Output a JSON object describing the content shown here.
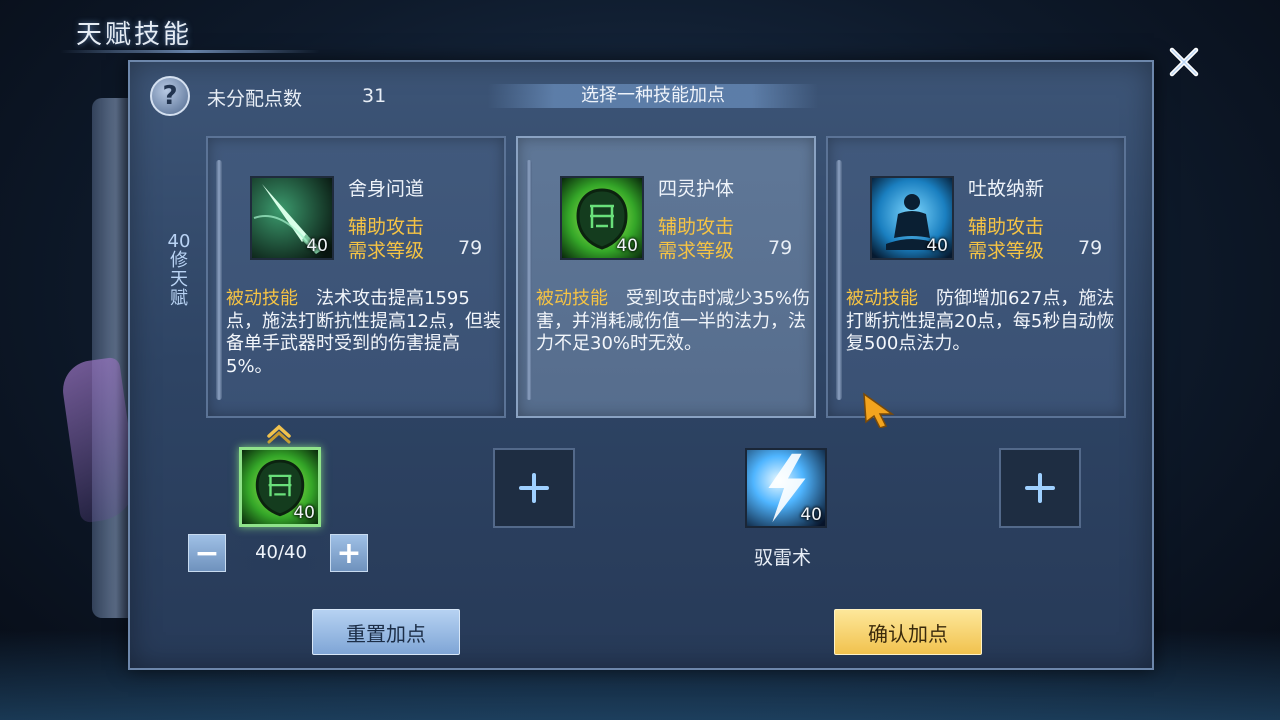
{
  "window": {
    "title": "天赋技能"
  },
  "header": {
    "unassigned_label": "未分配点数",
    "unassigned_points": "31",
    "select_prompt": "选择一种技能加点",
    "help_symbol": "?"
  },
  "talent_level_label": "40修天赋",
  "cards": [
    {
      "name": "舍身问道",
      "icon": "sword-slash-icon",
      "level": "40",
      "type": "辅助攻击",
      "req_label": "需求等级",
      "req_level": "79",
      "desc_tag": "被动技能",
      "desc": "法术攻击提高1595点，施法打断抗性提高12点，但装备单手武器时受到的伤害提高5%。",
      "selected": false
    },
    {
      "name": "四灵护体",
      "icon": "green-shield-icon",
      "level": "40",
      "type": "辅助攻击",
      "req_label": "需求等级",
      "req_level": "79",
      "desc_tag": "被动技能",
      "desc": "受到攻击时减少35%伤害，并消耗减伤值一半的法力，法力不足30%时无效。",
      "selected": true
    },
    {
      "name": "吐故纳新",
      "icon": "meditation-icon",
      "level": "40",
      "type": "辅助攻击",
      "req_label": "需求等级",
      "req_level": "79",
      "desc_tag": "被动技能",
      "desc": "防御增加627点，施法打断抗性提高20点，每5秒自动恢复500点法力。",
      "selected": false
    }
  ],
  "slots": [
    {
      "state": "filled",
      "icon": "green-shield-icon",
      "level": "40",
      "active": true
    },
    {
      "state": "empty",
      "icon": "plus-icon"
    },
    {
      "state": "filled",
      "icon": "lightning-icon",
      "level": "40",
      "caption": "驭雷术"
    },
    {
      "state": "empty",
      "icon": "plus-icon"
    }
  ],
  "stepper": {
    "minus": "−",
    "plus": "+",
    "value": "40/40"
  },
  "buttons": {
    "reset": "重置加点",
    "confirm": "确认加点"
  },
  "colors": {
    "accent_gold": "#f5c344",
    "panel": "#2e4464",
    "confirm": "#f1c24e",
    "reset": "#7fa5d6"
  }
}
